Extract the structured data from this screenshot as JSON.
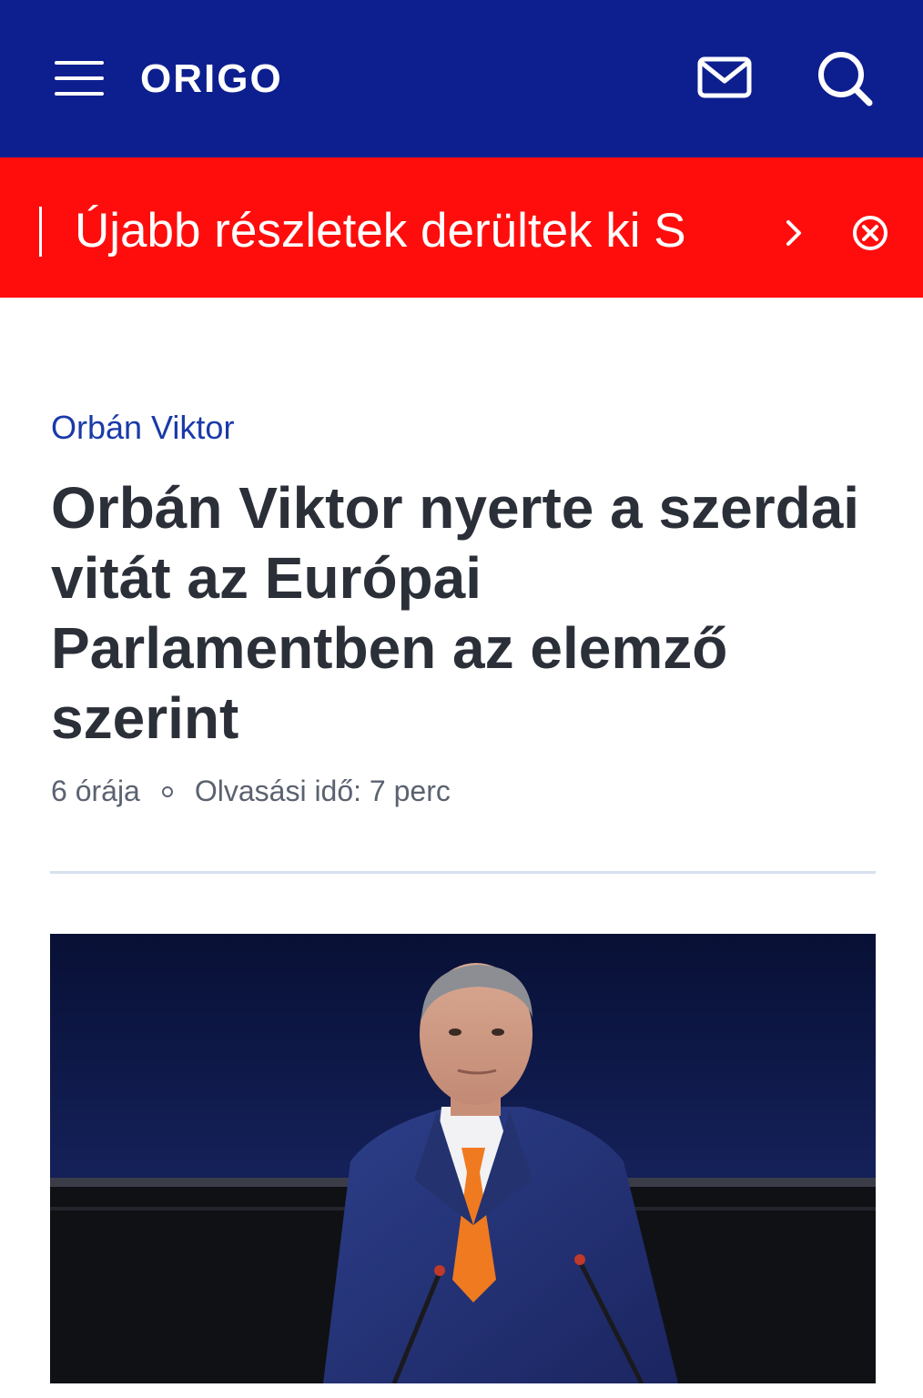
{
  "header": {
    "logo": "ORIGO",
    "menu_icon": "hamburger-menu-icon",
    "mail_icon": "mail-icon",
    "search_icon": "search-icon",
    "colors": {
      "background": "#0d1f8f",
      "foreground": "#ffffff"
    }
  },
  "breaking": {
    "text": "Újabb részletek derültek ki S",
    "next_icon": "chevron-right-icon",
    "close_icon": "close-circle-icon",
    "colors": {
      "background": "#ff0d0d",
      "foreground": "#ffffff"
    }
  },
  "article": {
    "category": "Orbán Viktor",
    "title": "Orbán Viktor nyerte a szerdai vitát az Európai Parlamentben az elemző szerint",
    "time_ago": "6 órája",
    "reading_time": "Olvasási idő: 7 perc",
    "colors": {
      "category": "#1a3aa8",
      "title": "#2b2f38",
      "meta": "#5b6270"
    }
  },
  "photo": {
    "icon": "article-photo"
  }
}
